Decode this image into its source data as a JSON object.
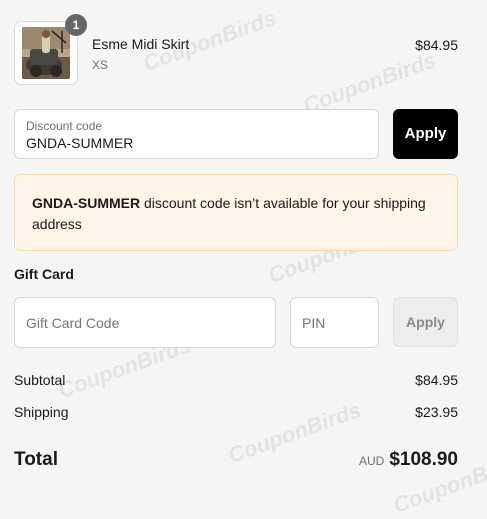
{
  "product": {
    "quantity": "1",
    "name": "Esme Midi Skirt",
    "variant": "XS",
    "price": "$84.95"
  },
  "discount": {
    "label": "Discount code",
    "value": "GNDA-SUMMER",
    "apply_label": "Apply"
  },
  "alert": {
    "code": "GNDA-SUMMER",
    "message": " discount code isn’t available for your shipping address"
  },
  "gift_card": {
    "title": "Gift Card",
    "code_placeholder": "Gift Card Code",
    "pin_placeholder": "PIN",
    "apply_label": "Apply"
  },
  "summary": {
    "subtotal_label": "Subtotal",
    "subtotal_value": "$84.95",
    "shipping_label": "Shipping",
    "shipping_value": "$23.95",
    "total_label": "Total",
    "currency": "AUD",
    "total_value": "$108.90"
  },
  "watermark_text": "CouponBirds"
}
